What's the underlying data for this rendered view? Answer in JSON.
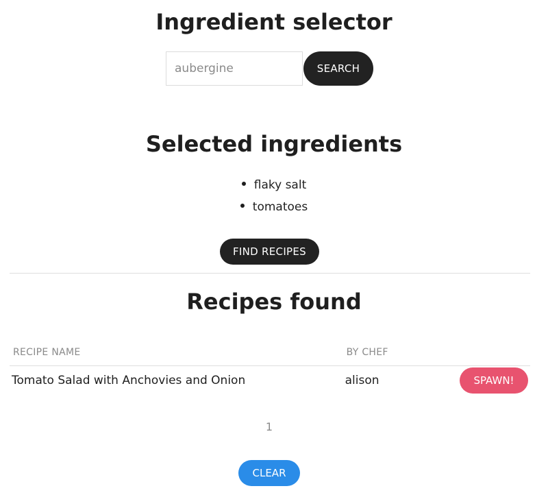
{
  "selector": {
    "title": "Ingredient selector",
    "search_placeholder": "aubergine",
    "search_value": "",
    "search_button": "SEARCH"
  },
  "selected": {
    "title": "Selected ingredients",
    "items": [
      "flaky salt",
      "tomatoes"
    ],
    "find_button": "FIND RECIPES"
  },
  "recipes": {
    "title": "Recipes found",
    "columns": [
      "RECIPE NAME",
      "BY CHEF",
      ""
    ],
    "rows": [
      {
        "name": "Tomato Salad with Anchovies and Onion",
        "chef": "alison",
        "action": "SPAWN!"
      }
    ],
    "pagination": {
      "current_page": "1"
    },
    "clear_button": "CLEAR"
  },
  "colors": {
    "dark_button": "#222222",
    "spawn_button": "#e8536f",
    "clear_button": "#2a8ce8",
    "muted_text": "#8a8a8a"
  }
}
